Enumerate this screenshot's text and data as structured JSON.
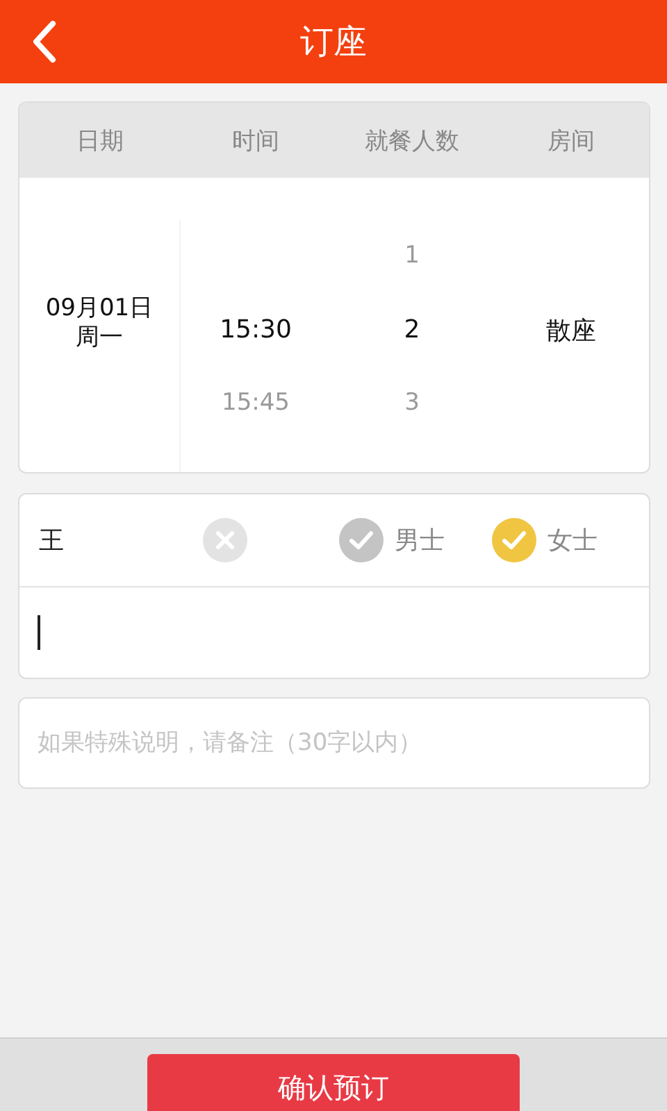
{
  "header": {
    "title": "订座"
  },
  "reservation": {
    "columns": [
      "日期",
      "时间",
      "就餐人数",
      "房间"
    ],
    "date": {
      "day": "09月01日",
      "weekday": "周一"
    },
    "times": [
      {
        "label": "15:30",
        "selected": true
      },
      {
        "label": "15:45",
        "selected": false
      }
    ],
    "party_sizes": [
      {
        "label": "1",
        "selected": false
      },
      {
        "label": "2",
        "selected": true
      },
      {
        "label": "3",
        "selected": false
      }
    ],
    "room": "散座"
  },
  "contact": {
    "name": "王",
    "genders": [
      {
        "label": "男士",
        "selected": false
      },
      {
        "label": "女士",
        "selected": true
      }
    ],
    "phone": {
      "focused": true
    }
  },
  "remarks": {
    "placeholder": "如果特殊说明，请备注（30字以内）"
  },
  "submit": "确认预订"
}
